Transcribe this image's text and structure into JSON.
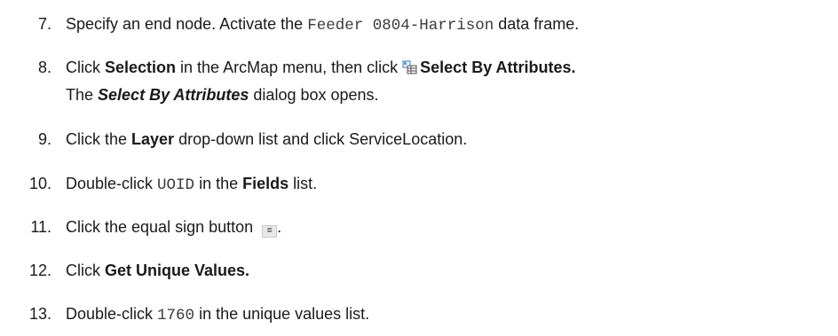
{
  "steps": [
    {
      "num": "7.",
      "t1": "Specify an end node. Activate the ",
      "code": "Feeder 0804-Harrison",
      "t2": " data frame."
    },
    {
      "num": "8.",
      "t1": "Click ",
      "b1": "Selection",
      "t2": " in the ArcMap menu, then click ",
      "b2": "Select By Attributes.",
      "l2_t1": "The ",
      "l2_bi": "Select By Attributes",
      "l2_t2": " dialog box opens."
    },
    {
      "num": "9.",
      "t1": "Click the ",
      "b1": "Layer",
      "t2": " drop-down list and click ServiceLocation."
    },
    {
      "num": "10.",
      "t1": "Double-click ",
      "code": "UOID",
      "t2": " in the ",
      "b1": "Fields",
      "t3": " list."
    },
    {
      "num": "11.",
      "t1": "Click the equal sign button ",
      "eq": "=",
      "t2": "."
    },
    {
      "num": "12.",
      "t1": "Click ",
      "b1": "Get Unique Values."
    },
    {
      "num": "13.",
      "t1": "Double-click ",
      "code": "1760",
      "t2": " in the unique values list."
    }
  ]
}
